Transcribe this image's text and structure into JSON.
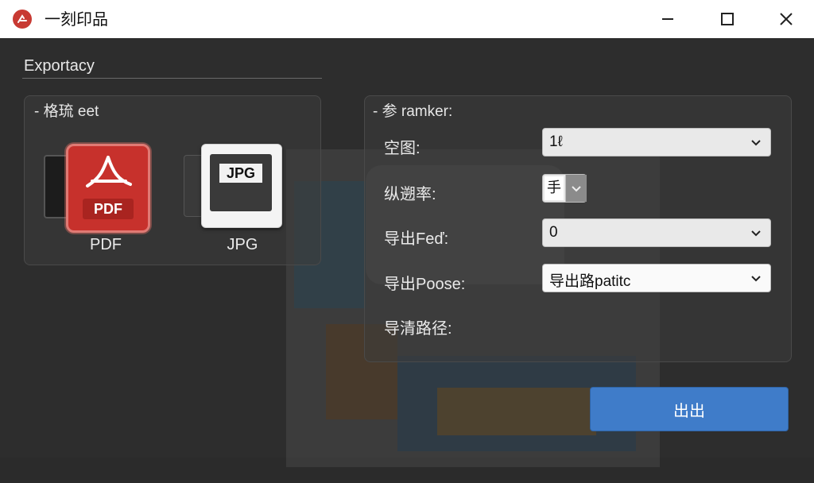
{
  "window": {
    "title": "一刻印品"
  },
  "export": {
    "section_title": "Exportacy"
  },
  "format_panel": {
    "legend": "- 格琉 eet",
    "formats": [
      {
        "label": "PDF",
        "icon_text": "PDF"
      },
      {
        "label": "JPG",
        "icon_text": "JPG"
      }
    ]
  },
  "params_panel": {
    "legend": "- 参 ramker:",
    "fields": {
      "size_label": "空图:",
      "size_value": "1ℓ",
      "resolution_label": "纵遡率:",
      "resolution_value": "手",
      "export_fee_label": "导出Feď:",
      "export_fee_value": "0",
      "export_pose_label": "导出Poose:",
      "export_pose_value": "导出路patitc",
      "path_label": "导清路径:"
    }
  },
  "actions": {
    "export_label": "出出"
  },
  "colors": {
    "accent": "#3f7cc9",
    "pdf_red": "#c7312c",
    "logo_red": "#c83a33"
  }
}
